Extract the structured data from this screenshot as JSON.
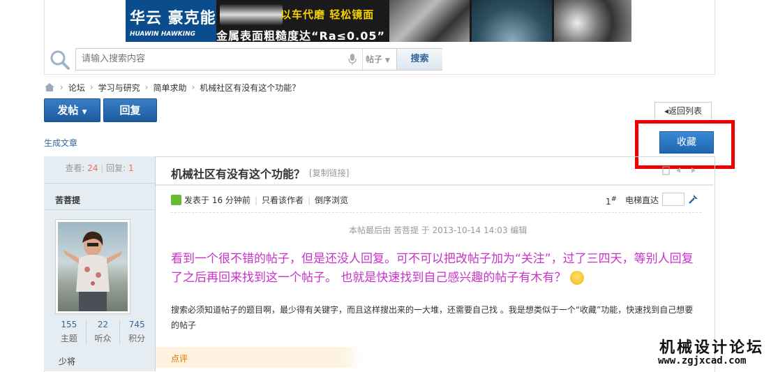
{
  "banner": {
    "logo_cn": "华云 豪克能",
    "logo_en": "HUAWIN HAWKING",
    "slogan": "以车代磨 轻松镜面",
    "text": "金属表面粗糙度达“Ra≤0.05”"
  },
  "search": {
    "placeholder": "请输入搜索内容",
    "scope": "帖子",
    "button": "搜索"
  },
  "breadcrumb": [
    "论坛",
    "学习与研究",
    "简单求助",
    "机械社区有没有这个功能？"
  ],
  "actions": {
    "post": "发帖",
    "reply": "回复",
    "back": "返回列表",
    "generate_article": "生成文章",
    "favorite": "收藏"
  },
  "thread_stats": {
    "views_label": "查看:",
    "views": "24",
    "replies_label": "回复:",
    "replies": "1"
  },
  "author": {
    "name": "苦菩提",
    "topics": "155",
    "topics_label": "主题",
    "listeners": "22",
    "listeners_label": "听众",
    "points": "745",
    "points_label": "积分",
    "rank": "少将"
  },
  "post": {
    "title": "机械社区有没有这个功能？",
    "copy_link": "[复制链接]",
    "posted": "发表于 16 分钟前",
    "only_author": "只看该作者",
    "reverse": "倒序浏览",
    "floor": "1",
    "floor_sup": "#",
    "elevator": "电梯直达",
    "edit_note": "本帖最后由 苦菩提 于 2013-10-14 14:03 编辑",
    "body1": "看到一个很不错的帖子，但是还没人回复。可不可以把改帖子加为“关注”，过了三四天，等别人回复了之后再回来找到这一个帖子。    也就是快速找到自己感兴趣的帖子有木有？",
    "body2": "搜索必须知道帖子的题目啊，最少得有关键字，而且这样搜出来的一大堆，还需要自己找  。我是想类似于一个“收藏”功能，快速找到自己想要的帖子",
    "rate": "点评"
  },
  "watermark": {
    "title": "机械设计论坛",
    "url": "www.zgjxcad.com"
  },
  "colors": {
    "button_blue": "#1c5a9e",
    "highlight_red": "#ee0000",
    "body_magenta": "#c832c8"
  }
}
